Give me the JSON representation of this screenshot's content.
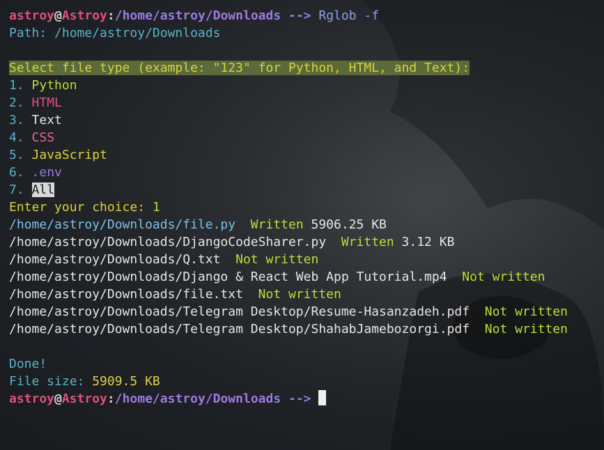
{
  "colors": {
    "background": "#1c1f24",
    "user": "#e0507e",
    "path": "#9b7be0",
    "cyan": "#5ab3c8",
    "yellow": "#d8d23a",
    "green": "#b8e03a"
  },
  "prompt1": {
    "user": "astroy",
    "at": "@",
    "host": "Astroy",
    "sep": ":",
    "path": "/home/astroy/Downloads",
    "arrow": " -->",
    "command": " Rglob -f"
  },
  "path_line": "Path: /home/astroy/Downloads",
  "select_prompt": "Select file type (example: \"123\" for Python, HTML, and Text):",
  "options": [
    {
      "num": "1.",
      "label": "Python"
    },
    {
      "num": "2.",
      "label": "HTML"
    },
    {
      "num": "3.",
      "label": "Text"
    },
    {
      "num": "4.",
      "label": "CSS"
    },
    {
      "num": "5.",
      "label": "JavaScript"
    },
    {
      "num": "6.",
      "label": ".env"
    },
    {
      "num": "7.",
      "label": "All"
    }
  ],
  "choice": {
    "label": "Enter your choice: ",
    "value": "1"
  },
  "results": [
    {
      "path": "/home/astroy/Downloads/file.py",
      "status": "Written",
      "size": "5906.25 KB"
    },
    {
      "path": "/home/astroy/Downloads/DjangoCodeSharer.py",
      "status": "Written",
      "size": "3.12 KB"
    },
    {
      "path": "/home/astroy/Downloads/Q.txt",
      "status": "Not written",
      "size": ""
    },
    {
      "path": "/home/astroy/Downloads/Django & React Web App Tutorial.mp4",
      "status": "Not written",
      "size": ""
    },
    {
      "path": "/home/astroy/Downloads/file.txt",
      "status": "Not written",
      "size": ""
    },
    {
      "path": "/home/astroy/Downloads/Telegram Desktop/Resume-Hasanzadeh.pdf",
      "status": "Not written",
      "size": ""
    },
    {
      "path": "/home/astroy/Downloads/Telegram Desktop/ShahabJamebozorgi.pdf",
      "status": "Not written",
      "size": ""
    }
  ],
  "done": "Done!",
  "file_size": {
    "label": "File size: ",
    "value": "5909.5 KB"
  },
  "prompt2": {
    "user": "astroy",
    "at": "@",
    "host": "Astroy",
    "sep": ":",
    "path": "/home/astroy/Downloads",
    "arrow": " --> "
  }
}
